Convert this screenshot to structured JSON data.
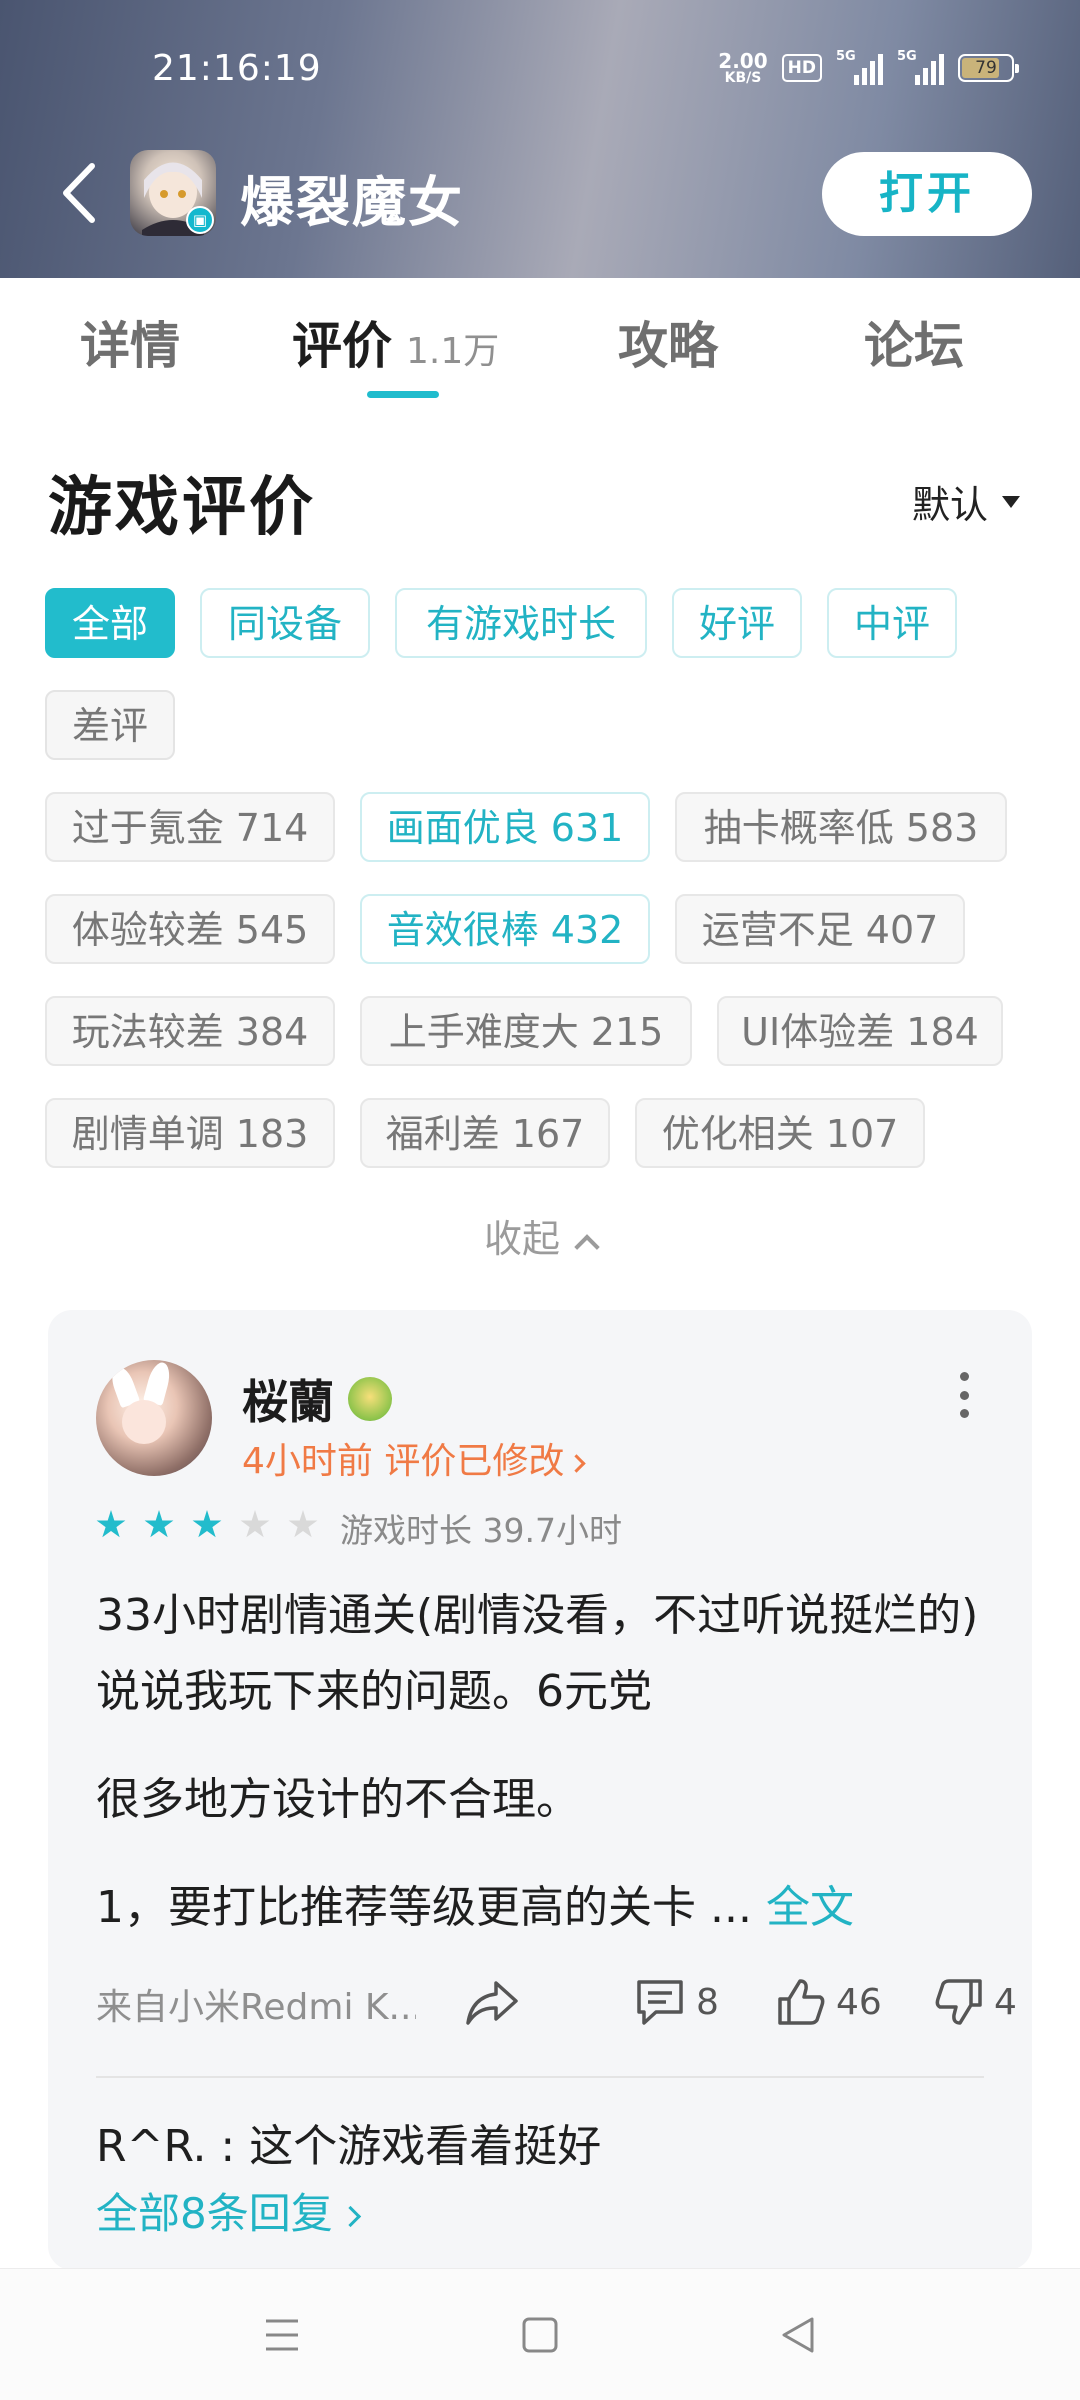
{
  "status_bar": {
    "time": "21:16:19",
    "net_speed_value": "2.00",
    "net_speed_unit": "KB/S",
    "hd_badge": "HD",
    "signal1_label": "5G",
    "signal2_label": "5G",
    "battery": "79"
  },
  "header": {
    "app_title": "爆裂魔女",
    "open_button": "打开",
    "tv_badge": "▣"
  },
  "tabs": [
    {
      "label": "详情"
    },
    {
      "label": "评价",
      "count": "1.1万"
    },
    {
      "label": "攻略"
    },
    {
      "label": "论坛"
    }
  ],
  "section": {
    "title": "游戏评价",
    "sort_label": "默认"
  },
  "filters": [
    {
      "label": "全部"
    },
    {
      "label": "同设备"
    },
    {
      "label": "有游戏时长"
    },
    {
      "label": "好评"
    },
    {
      "label": "中评"
    },
    {
      "label": "差评"
    }
  ],
  "tags": [
    {
      "label": "过于氪金 714"
    },
    {
      "label": "画面优良 631"
    },
    {
      "label": "抽卡概率低 583"
    },
    {
      "label": "体验较差 545"
    },
    {
      "label": "音效很棒 432"
    },
    {
      "label": "运营不足 407"
    },
    {
      "label": "玩法较差 384"
    },
    {
      "label": "上手难度大 215"
    },
    {
      "label": "UI体验差 184"
    },
    {
      "label": "剧情单调 183"
    },
    {
      "label": "福利差 167"
    },
    {
      "label": "优化相关 107"
    }
  ],
  "collapse_label": "收起",
  "review": {
    "username": "桜蘭",
    "meta": "4小时前 评价已修改",
    "rating": 3,
    "rating_max": 5,
    "playtime": "游戏时长 39.7小时",
    "paragraph1": "33小时剧情通关(剧情没看，不过听说挺烂的)说说我玩下来的问题。6元党",
    "paragraph2": "很多地方设计的不合理。",
    "paragraph3": "1，要打比推荐等级更高的关卡 ...",
    "full_text_link": "全文",
    "source": "来自小米Redmi K...",
    "comment_count": "8",
    "like_count": "46",
    "dislike_count": "4",
    "top_reply": "R^R. : 这个游戏看着挺好",
    "all_replies": "全部8条回复"
  },
  "colors": {
    "accent": "#22bccc",
    "orange": "#f07a45"
  }
}
